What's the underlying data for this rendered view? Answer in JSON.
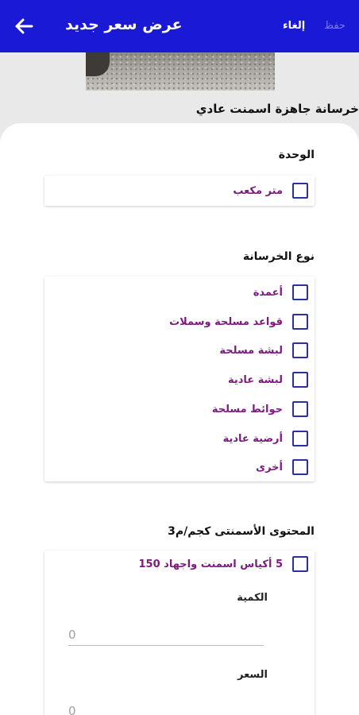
{
  "header": {
    "title": "عرض سعر جديد",
    "cancel_label": "إلغاء",
    "save_label": "حفظ"
  },
  "product": {
    "title": "خرسانة جاهزة اسمنت عادي"
  },
  "unit_section": {
    "label": "الوحدة",
    "options": [
      {
        "label": "متر مكعب",
        "checked": false
      }
    ]
  },
  "concrete_type_section": {
    "label": "نوع الخرسانة",
    "options": [
      {
        "label": "أعمدة",
        "checked": false
      },
      {
        "label": "قواعد مسلحة وسملات",
        "checked": false
      },
      {
        "label": "لبشة مسلحة",
        "checked": false
      },
      {
        "label": "لبشة عادية",
        "checked": false
      },
      {
        "label": "حوائط مسلحة",
        "checked": false
      },
      {
        "label": "أرضية عادية",
        "checked": false
      },
      {
        "label": "أخرى",
        "checked": false
      }
    ]
  },
  "cement_section": {
    "label": "المحتوى الأسمنتى كجم/م3",
    "options": [
      {
        "label": "5 أكياس اسمنت واجهاد 150",
        "checked": false
      }
    ],
    "quantity_label": "الكمية",
    "quantity_placeholder": "0",
    "price_label": "السعر",
    "price_placeholder": "0"
  },
  "colors": {
    "primary": "#1a1ad6",
    "checkbox_border": "#2b2ea8",
    "option_text": "#7b1a7f",
    "save_disabled": "#7b7bf0"
  }
}
